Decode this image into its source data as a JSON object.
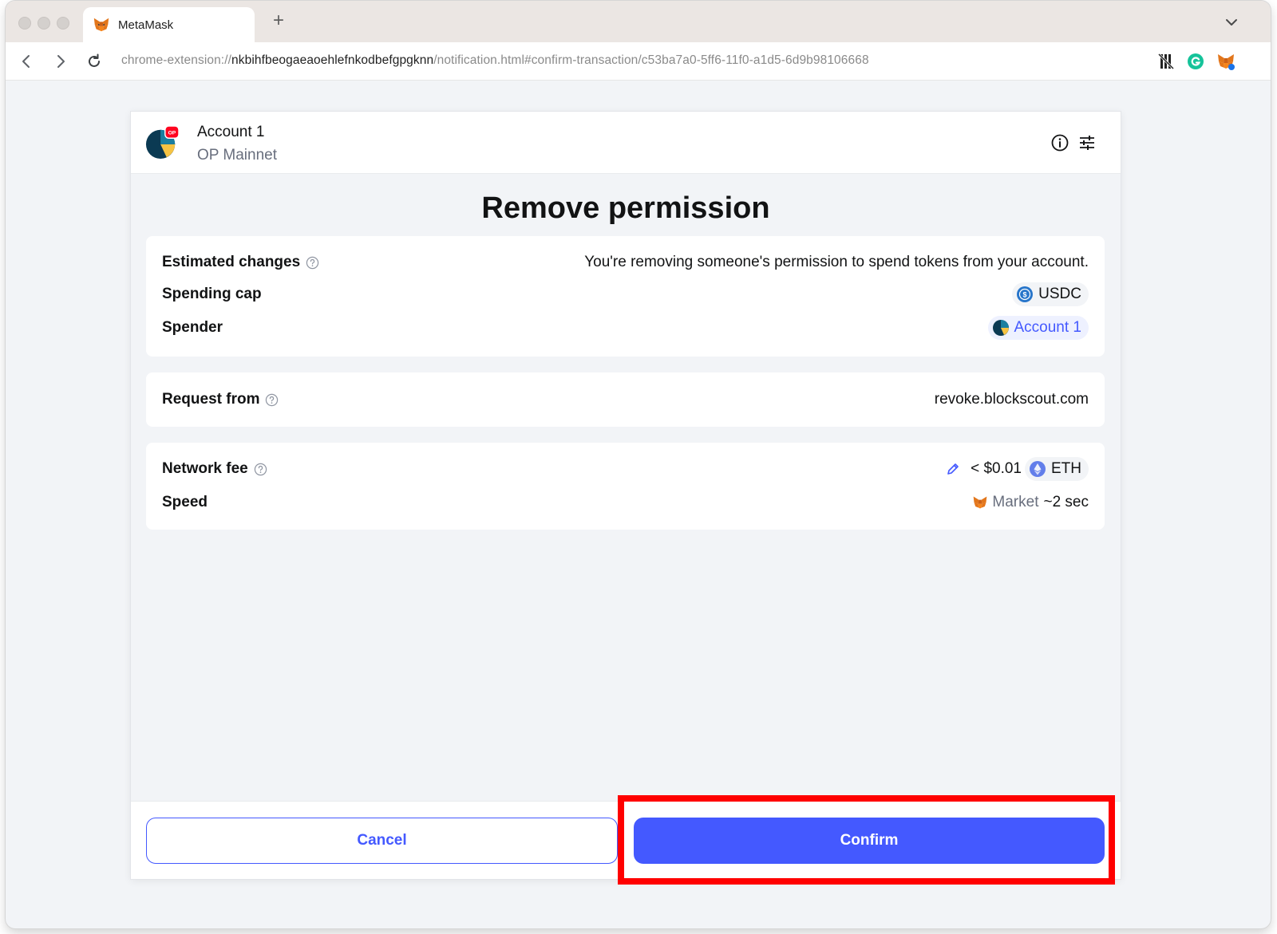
{
  "browser": {
    "tab_title": "MetaMask",
    "new_tab_symbol": "+",
    "url_scheme": "chrome-extension://",
    "url_host": "nkbihfbeogaeaoehlefnkodbefgpgknn",
    "url_path": "/notification.html#confirm-transaction/c53ba7a0-5ff6-11f0-a1d5-6d9b98106668"
  },
  "header": {
    "account_name": "Account 1",
    "network": "OP Mainnet",
    "network_badge": "OP"
  },
  "title": "Remove permission",
  "details": {
    "estimated_changes_label": "Estimated changes",
    "estimated_changes_value": "You're removing someone's permission to spend tokens from your account.",
    "spending_cap_label": "Spending cap",
    "spending_cap_token": "USDC",
    "spender_label": "Spender",
    "spender_value": "Account 1"
  },
  "request": {
    "label": "Request from",
    "value": "revoke.blockscout.com"
  },
  "fee": {
    "label": "Network fee",
    "value": "< $0.01",
    "token": "ETH",
    "speed_label": "Speed",
    "speed_mode": "Market",
    "speed_time": "~2 sec"
  },
  "footer": {
    "cancel_label": "Cancel",
    "confirm_label": "Confirm"
  },
  "colors": {
    "primary": "#4459ff",
    "highlight": "#ff0000",
    "panel_bg": "#f2f4f7"
  }
}
